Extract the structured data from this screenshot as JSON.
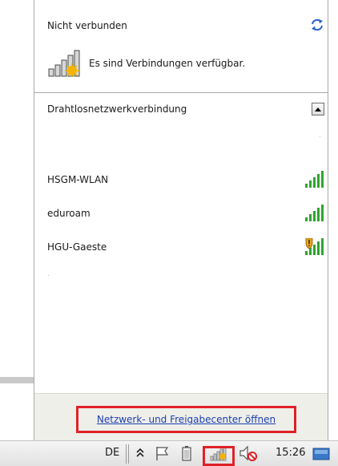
{
  "header": {
    "title": "Nicht verbunden",
    "availability_text": "Es sind Verbindungen verfügbar."
  },
  "section": {
    "title": "Drahtlosnetzwerkverbindung"
  },
  "networks": [
    {
      "name": "HSGM-WLAN",
      "secured": false,
      "signal_bars": 5
    },
    {
      "name": "eduroam",
      "secured": false,
      "signal_bars": 5
    },
    {
      "name": "HGU-Gaeste",
      "secured": true,
      "signal_bars": 5
    }
  ],
  "footer": {
    "link": "Netzwerk- und Freigabecenter öffnen"
  },
  "taskbar": {
    "language": "DE",
    "time": "15:26"
  },
  "colors": {
    "signal_green": "#2fa52f",
    "highlight_red": "#e02128",
    "link_blue": "#1c3fb0",
    "footer_bg": "#efefe9"
  },
  "icons": [
    "refresh-icon",
    "signal-warning-icon",
    "collapse-arrow-icon",
    "wifi-signal-icon",
    "shield-warning-icon",
    "chevron-up-icon",
    "flag-icon",
    "battery-icon",
    "network-icon",
    "volume-muted-icon",
    "desktop-icon"
  ]
}
